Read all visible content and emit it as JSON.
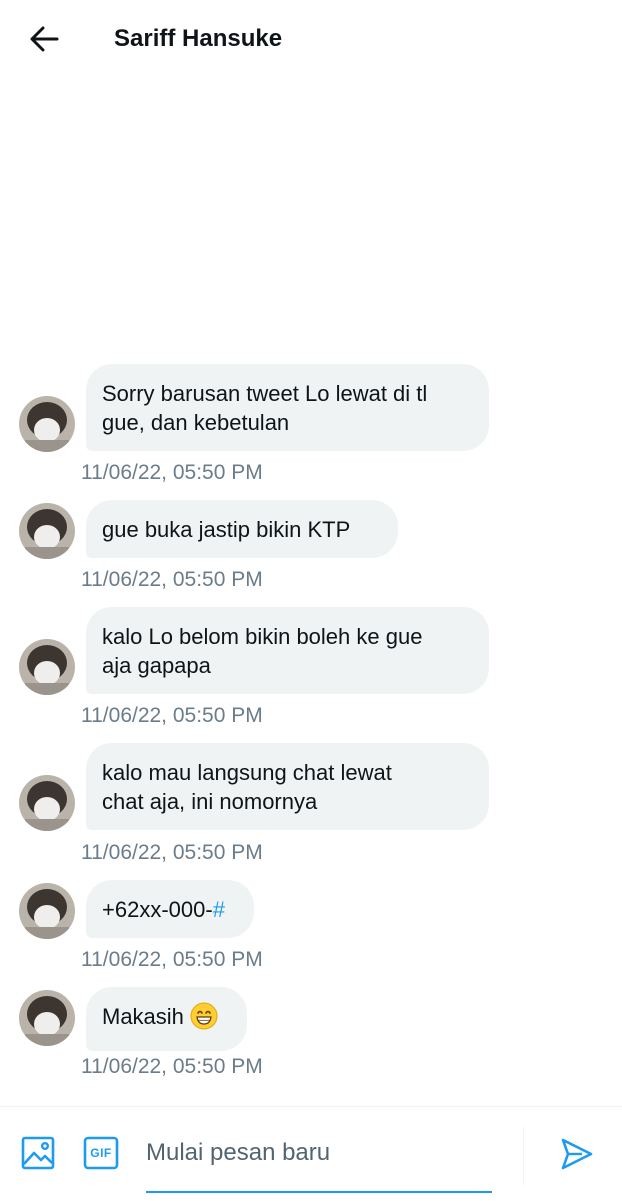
{
  "header": {
    "title": "Sariff Hansuke"
  },
  "messages": [
    {
      "lines": [
        "Sorry barusan tweet Lo lewat di tl",
        "gue, dan kebetulan"
      ],
      "time": "11/06/22, 05:50 PM"
    },
    {
      "lines": [
        "gue buka jastip bikin KTP"
      ],
      "time": "11/06/22, 05:50 PM"
    },
    {
      "lines": [
        "kalo Lo belom bikin boleh ke gue",
        "aja gapapa"
      ],
      "time": "11/06/22, 05:50 PM"
    },
    {
      "lines": [
        "kalo mau langsung chat lewat",
        "chat aja, ini nomornya"
      ],
      "time": "11/06/22, 05:50 PM"
    },
    {
      "text": "+62xx-000-",
      "hash": "#",
      "time": "11/06/22, 05:50 PM"
    },
    {
      "text": "Makasih",
      "emoji": "grinning-face-emoji",
      "time": "11/06/22, 05:50 PM"
    }
  ],
  "composer": {
    "placeholder": "Mulai pesan baru",
    "gif_label": "GIF"
  },
  "colors": {
    "accent": "#1d9bf0",
    "bubble": "#eff3f4",
    "timestamp": "#6b7c8a"
  }
}
